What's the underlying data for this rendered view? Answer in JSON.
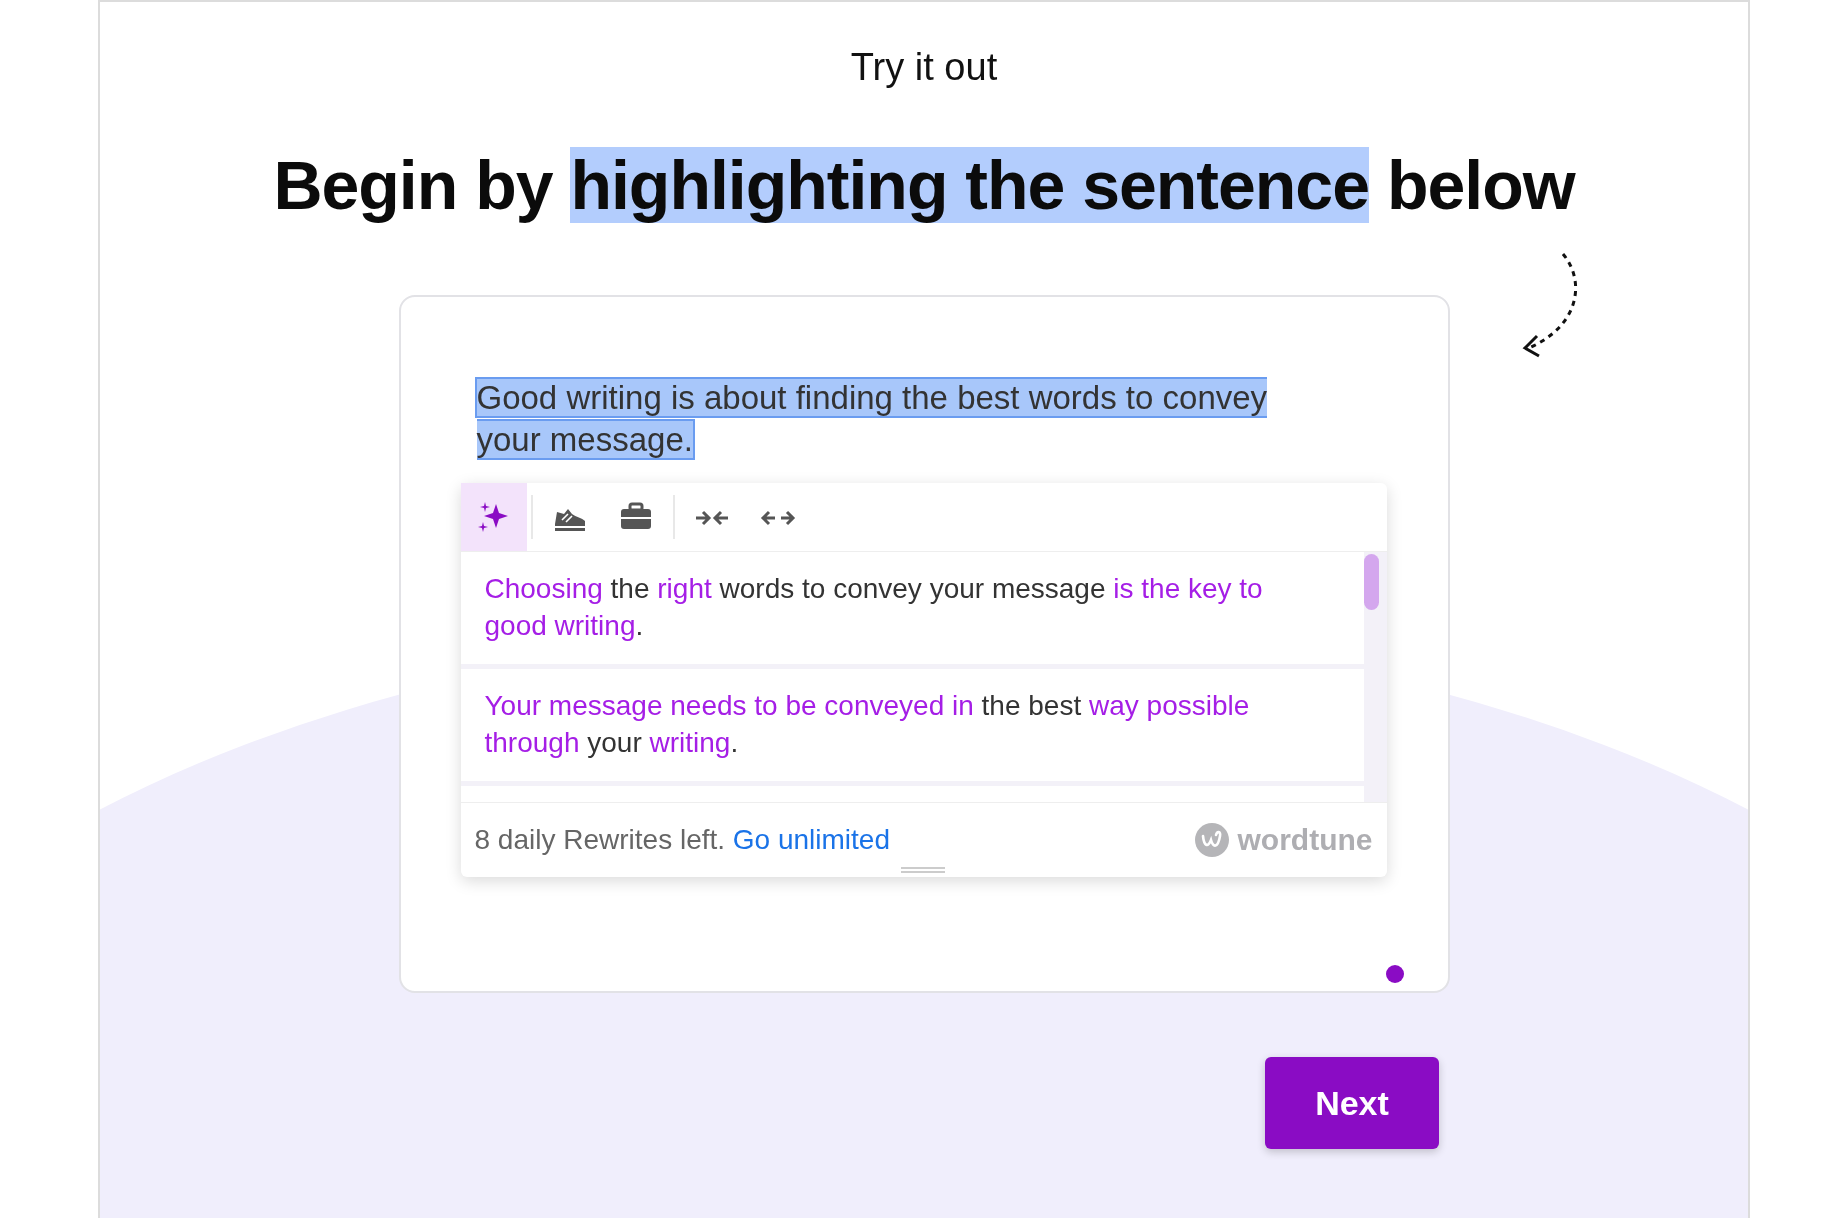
{
  "intro": "Try it out",
  "heading": [
    {
      "text": "Begin by ",
      "highlighted": false
    },
    {
      "text": "highlighting the sentence",
      "highlighted": true
    },
    {
      "text": " below",
      "highlighted": false
    }
  ],
  "sample": {
    "text": "Good writing is about finding the best words to convey your message.",
    "selected": true
  },
  "toolbar": [
    {
      "kind": "sparkle",
      "selected": true
    },
    {
      "kind": "divider"
    },
    {
      "kind": "casual",
      "selected": false
    },
    {
      "kind": "formal",
      "selected": false
    },
    {
      "kind": "divider"
    },
    {
      "kind": "shorten",
      "selected": false
    },
    {
      "kind": "expand",
      "selected": false
    }
  ],
  "suggestions": [
    [
      {
        "text": "Choosing",
        "changed": true
      },
      {
        "text": " the ",
        "changed": false
      },
      {
        "text": "right",
        "changed": true
      },
      {
        "text": " words to convey your message ",
        "changed": false
      },
      {
        "text": "is the key to good writing",
        "changed": true
      },
      {
        "text": ".",
        "changed": false
      }
    ],
    [
      {
        "text": "Your message needs to be conveyed in",
        "changed": true
      },
      {
        "text": " the best ",
        "changed": false
      },
      {
        "text": "way possible through",
        "changed": true
      },
      {
        "text": " your ",
        "changed": false
      },
      {
        "text": "writing",
        "changed": true
      },
      {
        "text": ".",
        "changed": false
      }
    ]
  ],
  "footer": {
    "remaining": "8 daily Rewrites left.",
    "link": "Go unlimited",
    "brand": "wordtune"
  },
  "next_button": "Next"
}
